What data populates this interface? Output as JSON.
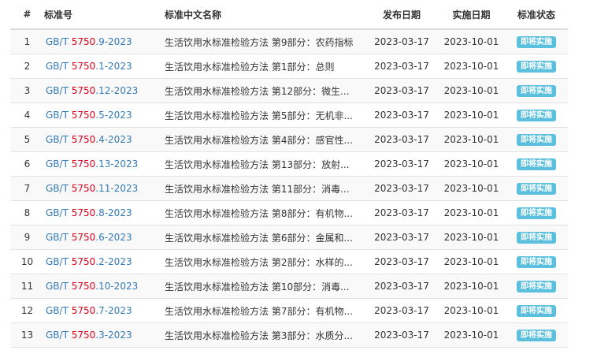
{
  "table": {
    "headers": {
      "num": "#",
      "code": "标准号",
      "name": "标准中文名称",
      "publish": "发布日期",
      "implement": "实施日期",
      "status": "标准状态"
    },
    "colors": {
      "link": "#337ab7",
      "highlight": "#e0001b",
      "badge": "#5bc0de"
    },
    "rows": [
      {
        "num": "1",
        "code_prefix": "GB/T ",
        "code_hl": "5750",
        "code_suffix": ".9-2023",
        "name": "生活饮用水标准检验方法 第9部分：农药指标",
        "publish": "2023-03-17",
        "implement": "2023-10-01",
        "status": "即将实施"
      },
      {
        "num": "2",
        "code_prefix": "GB/T ",
        "code_hl": "5750",
        "code_suffix": ".1-2023",
        "name": "生活饮用水标准检验方法 第1部分：总则",
        "publish": "2023-03-17",
        "implement": "2023-10-01",
        "status": "即将实施"
      },
      {
        "num": "3",
        "code_prefix": "GB/T ",
        "code_hl": "5750",
        "code_suffix": ".12-2023",
        "name": "生活饮用水标准检验方法 第12部分：微生...",
        "publish": "2023-03-17",
        "implement": "2023-10-01",
        "status": "即将实施"
      },
      {
        "num": "4",
        "code_prefix": "GB/T ",
        "code_hl": "5750",
        "code_suffix": ".5-2023",
        "name": "生活饮用水标准检验方法 第5部分：无机非...",
        "publish": "2023-03-17",
        "implement": "2023-10-01",
        "status": "即将实施"
      },
      {
        "num": "5",
        "code_prefix": "GB/T ",
        "code_hl": "5750",
        "code_suffix": ".4-2023",
        "name": "生活饮用水标准检验方法 第4部分：感官性...",
        "publish": "2023-03-17",
        "implement": "2023-10-01",
        "status": "即将实施"
      },
      {
        "num": "6",
        "code_prefix": "GB/T ",
        "code_hl": "5750",
        "code_suffix": ".13-2023",
        "name": "生活饮用水标准检验方法 第13部分：放射...",
        "publish": "2023-03-17",
        "implement": "2023-10-01",
        "status": "即将实施"
      },
      {
        "num": "7",
        "code_prefix": "GB/T ",
        "code_hl": "5750",
        "code_suffix": ".11-2023",
        "name": "生活饮用水标准检验方法 第11部分：消毒...",
        "publish": "2023-03-17",
        "implement": "2023-10-01",
        "status": "即将实施"
      },
      {
        "num": "8",
        "code_prefix": "GB/T ",
        "code_hl": "5750",
        "code_suffix": ".8-2023",
        "name": "生活饮用水标准检验方法 第8部分：有机物...",
        "publish": "2023-03-17",
        "implement": "2023-10-01",
        "status": "即将实施"
      },
      {
        "num": "9",
        "code_prefix": "GB/T ",
        "code_hl": "5750",
        "code_suffix": ".6-2023",
        "name": "生活饮用水标准检验方法 第6部分：金属和...",
        "publish": "2023-03-17",
        "implement": "2023-10-01",
        "status": "即将实施"
      },
      {
        "num": "10",
        "code_prefix": "GB/T ",
        "code_hl": "5750",
        "code_suffix": ".2-2023",
        "name": "生活饮用水标准检验方法 第2部分：水样的...",
        "publish": "2023-03-17",
        "implement": "2023-10-01",
        "status": "即将实施"
      },
      {
        "num": "11",
        "code_prefix": "GB/T ",
        "code_hl": "5750",
        "code_suffix": ".10-2023",
        "name": "生活饮用水标准检验方法 第10部分：消毒...",
        "publish": "2023-03-17",
        "implement": "2023-10-01",
        "status": "即将实施"
      },
      {
        "num": "12",
        "code_prefix": "GB/T ",
        "code_hl": "5750",
        "code_suffix": ".7-2023",
        "name": "生活饮用水标准检验方法 第7部分：有机物...",
        "publish": "2023-03-17",
        "implement": "2023-10-01",
        "status": "即将实施"
      },
      {
        "num": "13",
        "code_prefix": "GB/T ",
        "code_hl": "5750",
        "code_suffix": ".3-2023",
        "name": "生活饮用水标准检验方法 第3部分：水质分...",
        "publish": "2023-03-17",
        "implement": "2023-10-01",
        "status": "即将实施"
      }
    ]
  }
}
